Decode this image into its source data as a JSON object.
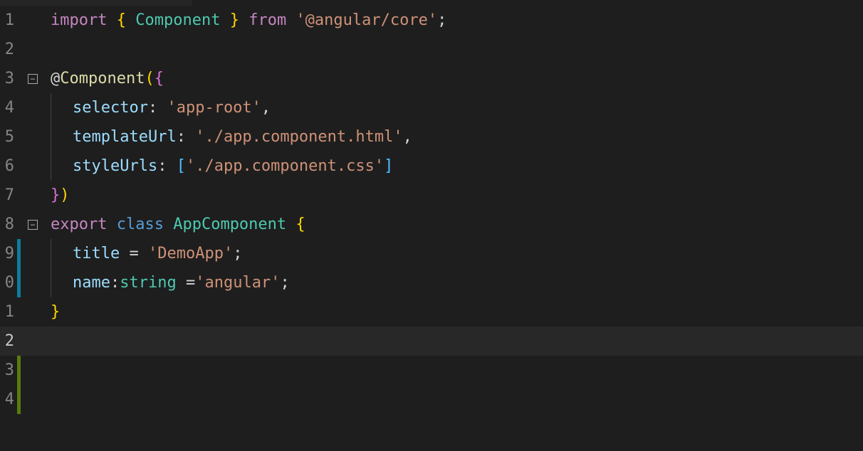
{
  "lines": {
    "n1": "1",
    "n2": "2",
    "n3": "3",
    "n4": "4",
    "n5": "5",
    "n6": "6",
    "n7": "7",
    "n8": "8",
    "n9": "9",
    "n10": "0",
    "n11": "1",
    "n12": "2",
    "n13": "3",
    "n14": "4"
  },
  "fold_minus": "⊟",
  "code": {
    "import": "import",
    "space": " ",
    "lbrace": "{",
    "rbrace": "}",
    "Component": "Component",
    "from": "from",
    "angular_core": "'@angular/core'",
    "semi": ";",
    "at": "@",
    "ComponentCall": "Component",
    "lparen": "(",
    "rparen": ")",
    "selector": "selector",
    "colon": ":",
    "app_root": "'app-root'",
    "comma": ",",
    "templateUrl": "templateUrl",
    "template_val": "'./app.component.html'",
    "styleUrls": "styleUrls",
    "lbracket": "[",
    "rbracket": "]",
    "style_val": "'./app.component.css'",
    "export": "export",
    "class": "class",
    "AppComponent": "AppComponent",
    "title": "title",
    "eq": "=",
    "demoapp": "'DemoApp'",
    "name": "name",
    "string_t": "string",
    "angular": "'angular'"
  }
}
